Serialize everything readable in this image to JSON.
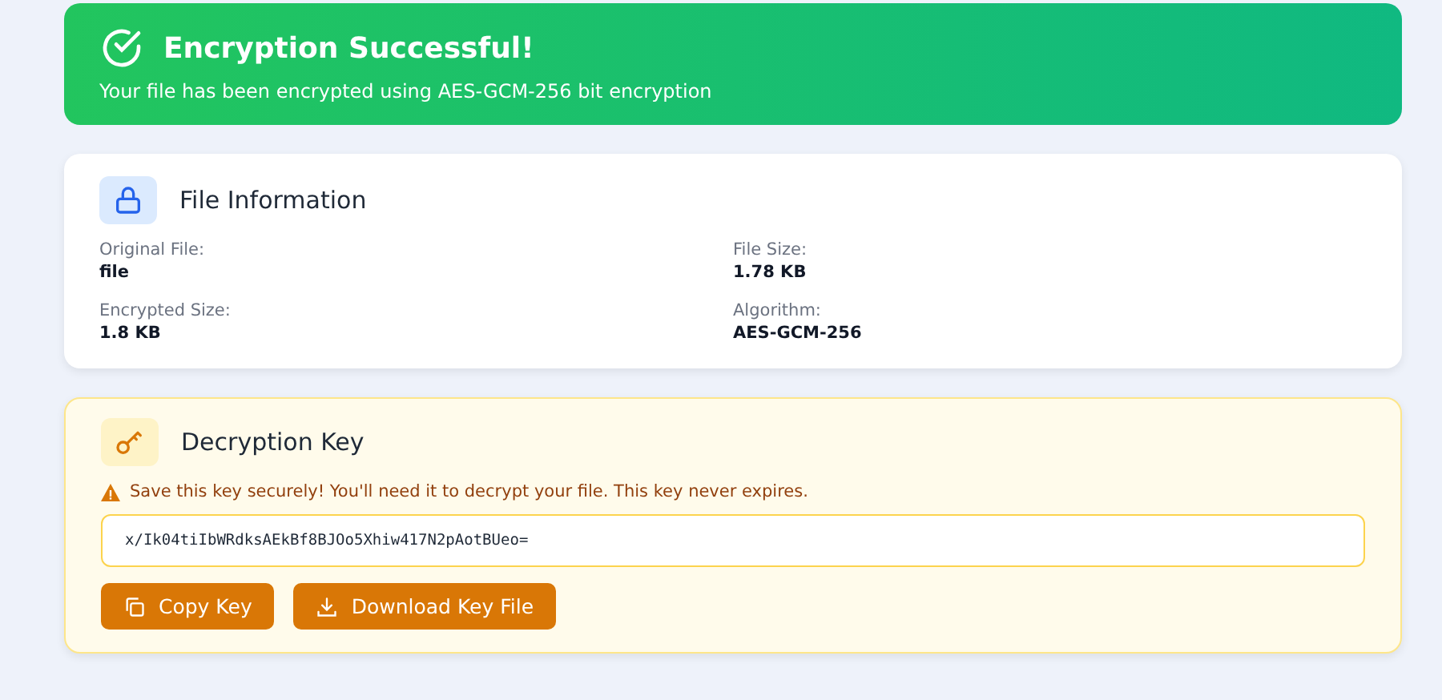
{
  "banner": {
    "title": "Encryption Successful!",
    "message": "Your file has been encrypted using AES-GCM-256 bit encryption"
  },
  "file_info": {
    "title": "File Information",
    "fields": [
      {
        "label": "Original File:",
        "value": "file"
      },
      {
        "label": "File Size:",
        "value": "1.78 KB"
      },
      {
        "label": "Encrypted Size:",
        "value": "1.8 KB"
      },
      {
        "label": "Algorithm:",
        "value": "AES-GCM-256"
      }
    ]
  },
  "decryption_key": {
    "title": "Decryption Key",
    "warning": "Save this key securely! You'll need it to decrypt your file. This key never expires.",
    "key": "x/Ik04tiIbWRdksAEkBf8BJOo5Xhiw417N2pAotBUeo=",
    "buttons": [
      {
        "kind": "copy",
        "label": "Copy Key"
      },
      {
        "kind": "download",
        "label": "Download Key File"
      }
    ]
  }
}
